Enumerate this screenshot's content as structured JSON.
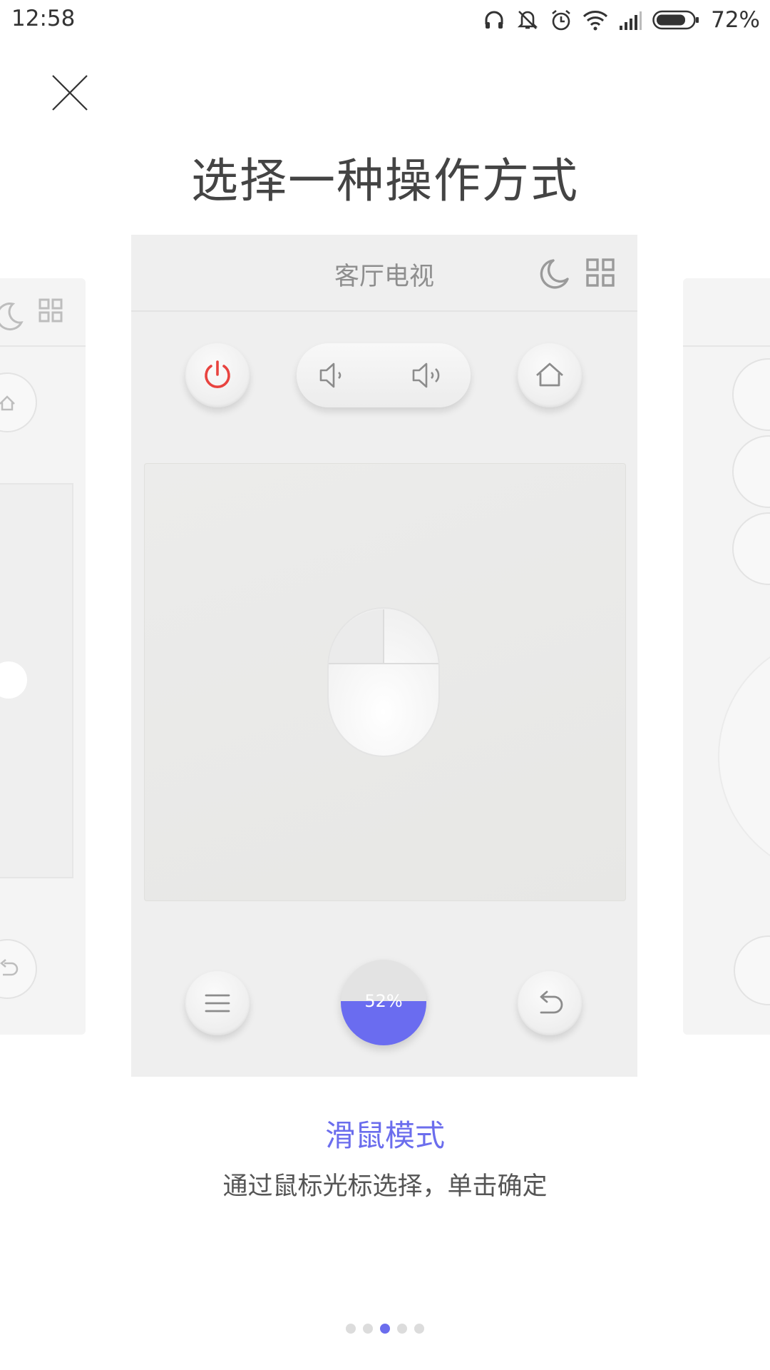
{
  "status_bar": {
    "time": "12:58",
    "battery_text": "72%",
    "icons": [
      "headphones-icon",
      "vibrate-mute-icon",
      "alarm-icon",
      "wifi-icon",
      "signal-icon",
      "battery-icon"
    ]
  },
  "page": {
    "title": "选择一种操作方式"
  },
  "card": {
    "header_title": "客厅电视",
    "touchpad_progress_text": "52%",
    "touchpad_progress_value": 0.52
  },
  "mode": {
    "name": "滑鼠模式",
    "description": "通过鼠标光标选择，单击确定"
  },
  "pagination": {
    "count": 5,
    "active_index": 2
  },
  "colors": {
    "accent": "#6b6ded",
    "power_red": "#e8433f",
    "background": "#ffffff",
    "card_bg": "#efefef"
  }
}
